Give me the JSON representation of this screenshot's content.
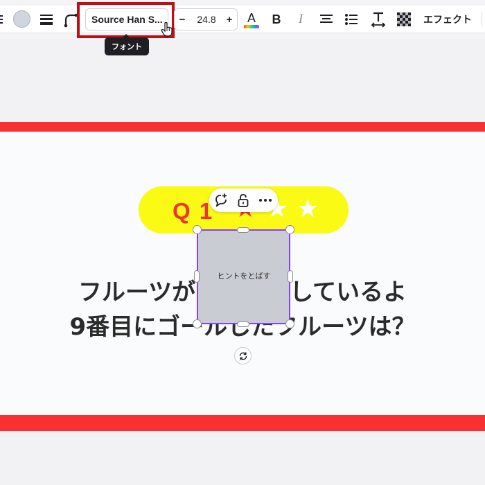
{
  "toolbar": {
    "font_name": "Source Han S...",
    "font_size": "24.8",
    "decrease_label": "−",
    "increase_label": "+",
    "bold_label": "B",
    "italic_label": "I",
    "text_color_label": "A",
    "effects_label": "エフェクト",
    "tooltip": "フォント",
    "colors": {
      "swatch": "#cfd6df",
      "highlight": "#c30d15"
    }
  },
  "slide": {
    "question_number": "Q 1",
    "stars": [
      "★",
      "★",
      "★"
    ],
    "line1": "フルーツがかけっこしているよ",
    "line2": "9番目にゴールしたフルーツは？",
    "hint_label": "ヒントをとばす",
    "colors": {
      "band": "#f73131",
      "pill": "#fafa14",
      "accent": "#ef3434",
      "selection": "#8b3dff"
    }
  },
  "icons": {
    "toolbar": [
      "lines-icon",
      "color-swatch",
      "border-style-icon",
      "corner-rounding-icon",
      "cursor-hand-icon",
      "text-color-icon",
      "bold-icon",
      "italic-icon",
      "align-center-icon",
      "bullet-list-icon",
      "letter-spacing-icon",
      "transparency-icon"
    ],
    "floating": [
      "comment-add-icon",
      "lock-icon",
      "more-icon",
      "rotate-icon"
    ]
  }
}
